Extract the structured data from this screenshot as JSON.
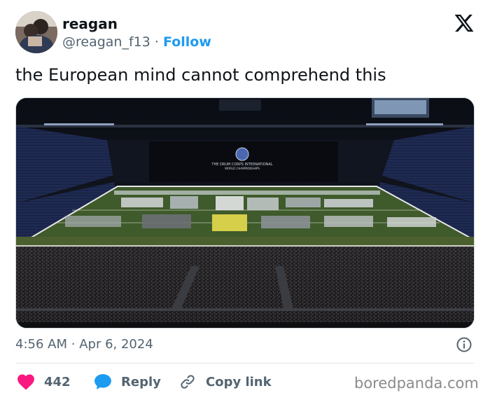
{
  "user": {
    "display_name": "reagan",
    "handle": "@reagan_f13",
    "separator": "·",
    "follow_label": "Follow"
  },
  "tweet": {
    "text": "the European mind cannot comprehend this",
    "time": "4:56 AM",
    "date_separator": "·",
    "date": "Apr 6, 2024"
  },
  "media": {
    "banner_line1": "THE DRUM CORPS INTERNATIONAL",
    "banner_line2": "WORLD CHAMPIONSHIPS"
  },
  "actions": {
    "like_count": "442",
    "reply_label": "Reply",
    "copy_label": "Copy link"
  },
  "icons": {
    "platform": "x-logo-icon",
    "like": "heart-icon",
    "reply": "speech-bubble-icon",
    "copy": "link-icon",
    "info": "info-icon"
  },
  "colors": {
    "accent": "#1d9bf0",
    "like": "#f91880",
    "muted_text": "#536471",
    "text": "#0f1419"
  },
  "watermark": "boredpanda.com"
}
